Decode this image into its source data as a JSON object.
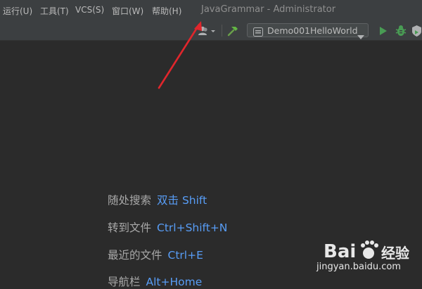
{
  "menu": {
    "items": [
      {
        "label": "运行(U)"
      },
      {
        "label": "工具(T)"
      },
      {
        "label": "VCS(S)"
      },
      {
        "label": "窗口(W)"
      },
      {
        "label": "帮助(H)"
      }
    ]
  },
  "window": {
    "title": "JavaGrammar - Administrator"
  },
  "toolbar": {
    "run_config": "Demo001HelloWorld",
    "icons": [
      "user-icon",
      "hammer-icon",
      "run-icon",
      "debug-icon",
      "coverage-icon"
    ]
  },
  "hints": [
    {
      "label": "随处搜索",
      "key": "双击 Shift"
    },
    {
      "label": "转到文件",
      "key": "Ctrl+Shift+N"
    },
    {
      "label": "最近的文件",
      "key": "Ctrl+E"
    },
    {
      "label": "导航栏",
      "key": "Alt+Home"
    }
  ],
  "watermark": {
    "text": "jingyan.baidu.com",
    "brand": "Bai",
    "brand2": "经验"
  },
  "colors": {
    "menubar": "#3c3f41",
    "editor": "#2b2b2b",
    "accent_key": "#589df6",
    "run_green": "#499c54",
    "annotation_arrow": "#e0262c"
  }
}
